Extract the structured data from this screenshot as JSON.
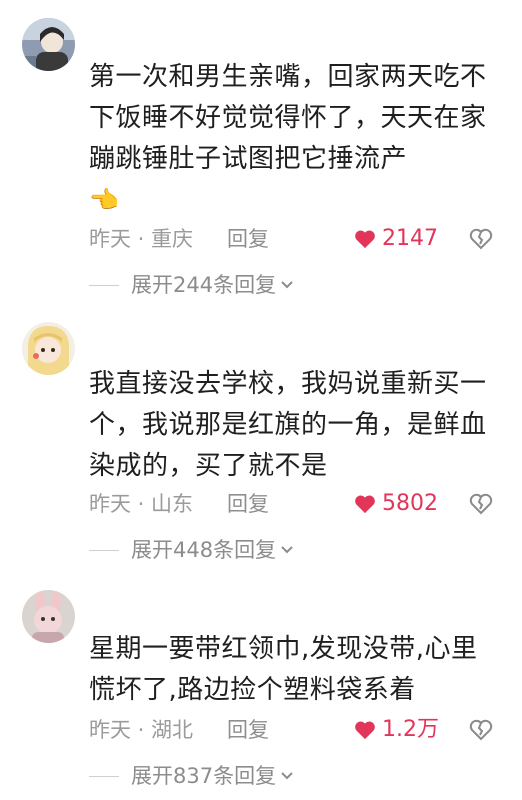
{
  "comments": [
    {
      "content": "第一次和男生亲嘴，回家两天吃不下饭睡不好觉觉得怀了，天天在家蹦跳锤肚子试图把它捶流产",
      "emoji": "👈",
      "time_location": "昨天 · 重庆",
      "reply_label": "回复",
      "likes": "2147",
      "expand_label": "展开244条回复"
    },
    {
      "content": "我直接没去学校，我妈说重新买一个，我说那是红旗的一角，是鲜血染成的，买了就不是",
      "time_location": "昨天 · 山东",
      "reply_label": "回复",
      "likes": "5802",
      "expand_label": "展开448条回复"
    },
    {
      "content": "星期一要带红领巾,发现没带,心里慌坏了,路边捡个塑料袋系着",
      "time_location": "昨天 · 湖北",
      "reply_label": "回复",
      "likes": "1.2万",
      "expand_label": "展开837条回复"
    }
  ],
  "colors": {
    "like": "#e2355a",
    "meta": "#9b9b9b",
    "text": "#1f1f1f"
  },
  "icons": {
    "like": "heart-icon",
    "dislike": "broken-heart-icon",
    "expand": "chevron-down-icon"
  }
}
